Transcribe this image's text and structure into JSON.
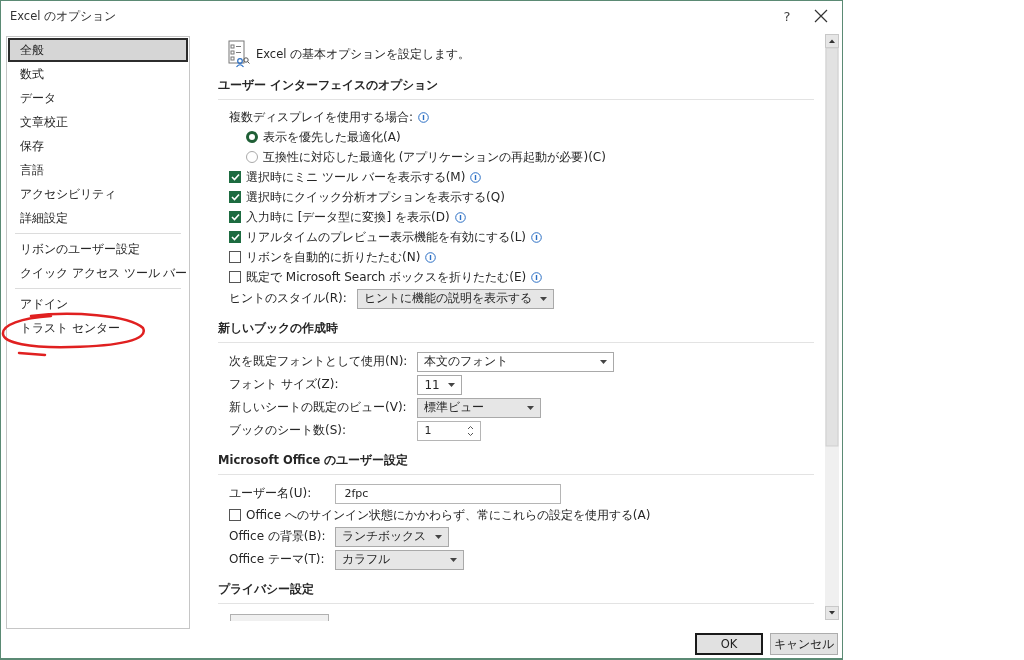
{
  "window": {
    "title": "Excel のオプション",
    "help": "?"
  },
  "sidebar": {
    "groups": [
      [
        {
          "label": "全般",
          "selected": true
        },
        {
          "label": "数式",
          "selected": false
        },
        {
          "label": "データ",
          "selected": false
        },
        {
          "label": "文章校正",
          "selected": false
        },
        {
          "label": "保存",
          "selected": false
        },
        {
          "label": "言語",
          "selected": false
        },
        {
          "label": "アクセシビリティ",
          "selected": false
        },
        {
          "label": "詳細設定",
          "selected": false
        }
      ],
      [
        {
          "label": "リボンのユーザー設定",
          "selected": false
        },
        {
          "label": "クイック アクセス ツール バー",
          "selected": false
        }
      ],
      [
        {
          "label": "アドイン",
          "selected": false
        },
        {
          "label": "トラスト センター",
          "selected": false
        }
      ]
    ]
  },
  "intro": "Excel の基本オプションを設定します。",
  "sections": [
    {
      "title": "ユーザー インターフェイスのオプション",
      "rows": [
        {
          "kind": "label",
          "text": "複数ディスプレイを使用する場合:",
          "info": true
        },
        {
          "kind": "radio",
          "text": "表示を優先した最適化(A)",
          "selected": true
        },
        {
          "kind": "radio",
          "text": "互換性に対応した最適化 (アプリケーションの再起動が必要)(C)",
          "selected": false
        },
        {
          "kind": "checkbox",
          "text": "選択時にミニ ツール バーを表示する(M)",
          "checked": true,
          "info": true
        },
        {
          "kind": "checkbox",
          "text": "選択時にクイック分析オプションを表示する(Q)",
          "checked": true,
          "info": false
        },
        {
          "kind": "checkbox",
          "text": "入力時に [データ型に変換] を表示(D)",
          "checked": true,
          "info": true
        },
        {
          "kind": "checkbox",
          "text": "リアルタイムのプレビュー表示機能を有効にする(L)",
          "checked": true,
          "info": true
        },
        {
          "kind": "checkbox",
          "text": "リボンを自動的に折りたたむ(N)",
          "checked": false,
          "info": true
        },
        {
          "kind": "checkbox",
          "text": "既定で Microsoft Search ボックスを折りたたむ(E)",
          "checked": false,
          "info": true
        },
        {
          "kind": "select",
          "label": "ヒントのスタイル(R):",
          "value": "ヒントに機能の説明を表示する"
        }
      ]
    },
    {
      "title": "新しいブックの作成時",
      "rows": [
        {
          "kind": "select",
          "label": "次を既定フォントとして使用(N):",
          "value": "本文のフォント"
        },
        {
          "kind": "select",
          "label": "フォント サイズ(Z):",
          "value": "11"
        },
        {
          "kind": "select",
          "label": "新しいシートの既定のビュー(V):",
          "value": "標準ビュー"
        },
        {
          "kind": "spinner",
          "label": "ブックのシート数(S):",
          "value": "1"
        }
      ]
    },
    {
      "title": "Microsoft Office のユーザー設定",
      "rows": [
        {
          "kind": "text",
          "label": "ユーザー名(U):",
          "value": "2fpc"
        },
        {
          "kind": "checkbox",
          "text": "Office へのサインイン状態にかかわらず、常にこれらの設定を使用する(A)",
          "checked": false,
          "info": false
        },
        {
          "kind": "select",
          "label": "Office の背景(B):",
          "value": "ランチボックス"
        },
        {
          "kind": "select",
          "label": "Office テーマ(T):",
          "value": "カラフル"
        }
      ]
    },
    {
      "title": "プライバシー設定"
    }
  ],
  "buttons": [
    {
      "label": "OK",
      "default": true
    },
    {
      "label": "キャンセル",
      "default": false
    }
  ]
}
